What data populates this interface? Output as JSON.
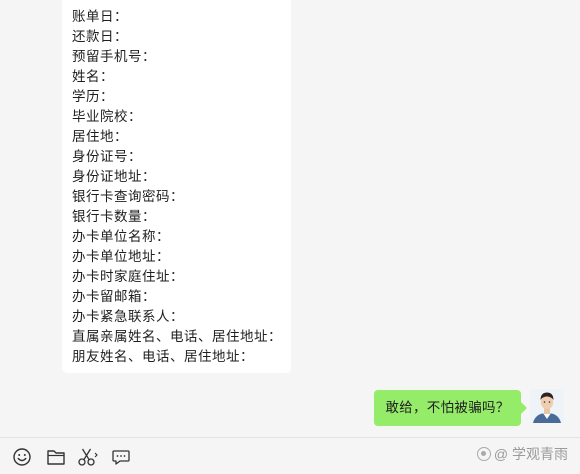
{
  "incoming_message": {
    "lines": [
      "账单日：",
      "还款日：",
      "预留手机号：",
      "姓名：",
      "学历：",
      "毕业院校：",
      "居住地：",
      "身份证号：",
      "身份证地址：",
      "银行卡查询密码：",
      "银行卡数量：",
      "办卡单位名称：",
      "办卡单位地址：",
      "办卡时家庭住址：",
      "办卡留邮箱：",
      "办卡紧急联系人：",
      "直属亲属姓名、电话、居住地址：",
      "朋友姓名、电话、居住地址："
    ]
  },
  "outgoing_message": {
    "text": "敢给，不怕被骗吗？"
  },
  "toolbar": {
    "icons": [
      "emoji-icon",
      "folder-icon",
      "scissors-icon",
      "chat-bubble-icon"
    ]
  },
  "watermark": {
    "text": "@ 学观青雨"
  },
  "colors": {
    "chat_background": "#f5f5f5",
    "incoming_bubble": "#ffffff",
    "outgoing_bubble": "#95ec69"
  }
}
